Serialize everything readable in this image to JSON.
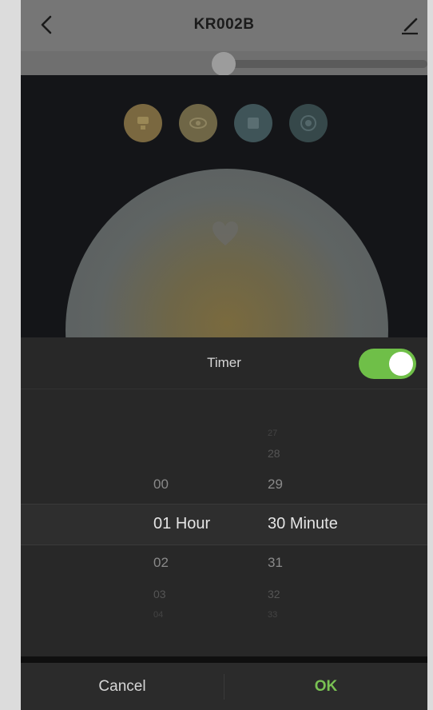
{
  "header": {
    "title": "KR002B"
  },
  "brightness": {
    "level_percent": 47
  },
  "mode_buttons": [
    {
      "name": "white-light",
      "color": "#7a6840"
    },
    {
      "name": "eye-care",
      "color": "#6f6646"
    },
    {
      "name": "color",
      "color": "#3f5458"
    },
    {
      "name": "scene",
      "color": "#36484a"
    }
  ],
  "timer": {
    "title": "Timer",
    "enabled": true,
    "hours": {
      "items": [
        "00",
        "01",
        "02",
        "03",
        "04"
      ],
      "selected": "01",
      "unit": "Hour"
    },
    "minutes": {
      "items": [
        "27",
        "28",
        "29",
        "30",
        "31",
        "32",
        "33"
      ],
      "selected": "30",
      "unit": "Minute"
    }
  },
  "actions": {
    "cancel": "Cancel",
    "ok": "OK"
  },
  "colors": {
    "accent": "#79c153",
    "toggle_on": "#6fbf48"
  }
}
